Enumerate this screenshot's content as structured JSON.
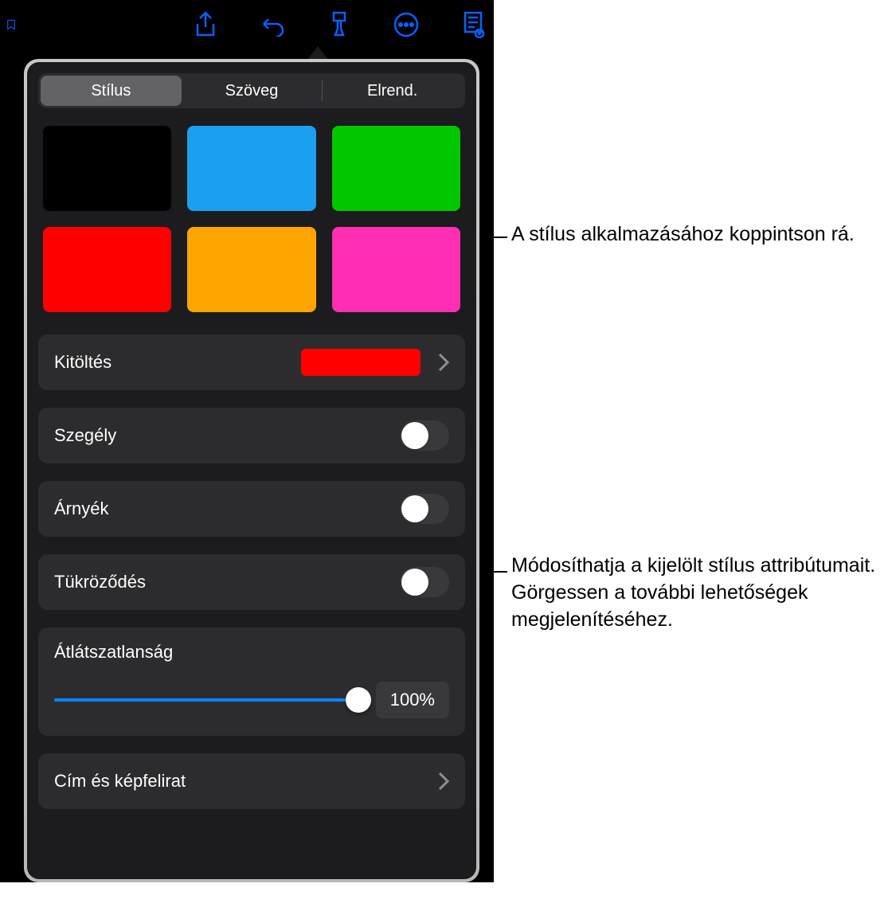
{
  "toolbar": {
    "icons": [
      "share-icon",
      "undo-icon",
      "format-brush-icon",
      "more-icon",
      "view-options-icon"
    ]
  },
  "tabs": [
    {
      "label": "Stílus",
      "active": true
    },
    {
      "label": "Szöveg",
      "active": false
    },
    {
      "label": "Elrend.",
      "active": false
    }
  ],
  "swatches": [
    "#000000",
    "#1a9ff1",
    "#00c700",
    "#ff0000",
    "#ffa500",
    "#ff2fb3"
  ],
  "fill": {
    "label": "Kitöltés",
    "color": "#ff0000"
  },
  "toggles": [
    {
      "label": "Szegély",
      "on": false
    },
    {
      "label": "Árnyék",
      "on": false
    },
    {
      "label": "Tükröződés",
      "on": false
    }
  ],
  "opacity": {
    "label": "Átlátszatlanság",
    "percent": 100,
    "display": "100%"
  },
  "title_caption": {
    "label": "Cím és képfelirat"
  },
  "callouts": {
    "top": "A stílus alkalmazásához koppintson rá.",
    "bottom": "Módosíthatja a kijelölt stílus attribútumait. Görgessen a további lehetőségek megjelenítéséhez."
  }
}
